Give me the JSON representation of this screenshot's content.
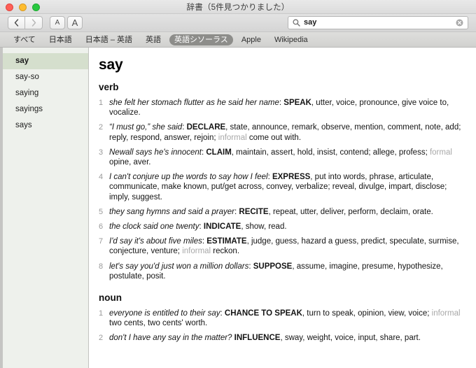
{
  "window": {
    "title": "辞書（5件見つかりました）",
    "traffic_lights": [
      "close-button",
      "minimize-button",
      "maximize-button"
    ]
  },
  "toolbar": {
    "back_label": "‹",
    "forward_label": "›",
    "text_smaller_label": "A",
    "text_larger_label": "A",
    "search": {
      "value": "say",
      "placeholder": "検索",
      "search_icon": "search-icon",
      "clear_icon": "clear-icon"
    }
  },
  "sources": {
    "items": [
      {
        "label": "すべて",
        "selected": false
      },
      {
        "label": "日本語",
        "selected": false
      },
      {
        "label": "日本語 – 英語",
        "selected": false
      },
      {
        "label": "英語",
        "selected": false
      },
      {
        "label": "英語シソーラス",
        "selected": true
      },
      {
        "label": "Apple",
        "selected": false
      },
      {
        "label": "Wikipedia",
        "selected": false
      }
    ],
    "selected_color": "#8d8d8a"
  },
  "sidebar": {
    "items": [
      {
        "label": "say",
        "selected": true
      },
      {
        "label": "say-so",
        "selected": false
      },
      {
        "label": "saying",
        "selected": false
      },
      {
        "label": "sayings",
        "selected": false
      },
      {
        "label": "says",
        "selected": false
      }
    ],
    "selected_bg": "#d5dfcd",
    "background": "#eef1ec"
  },
  "entry": {
    "headword": "say",
    "parts": [
      {
        "pos": "verb",
        "senses": [
          {
            "num": "1",
            "example": "she felt her stomach flutter as he said her name",
            "sep": ": ",
            "keyword": "SPEAK",
            "rest": ", utter, voice, pronounce, give voice to, vocalize."
          },
          {
            "num": "2",
            "example": "“I must go,” she said",
            "sep": ": ",
            "keyword": "DECLARE",
            "rest": ", state, announce, remark, observe, mention, comment, note, add; reply, respond, answer, rejoin; ",
            "register": "informal",
            "rest2": " come out with."
          },
          {
            "num": "3",
            "example": "Newall says he's innocent",
            "sep": ": ",
            "keyword": "CLAIM",
            "rest": ", maintain, assert, hold, insist, contend; allege, profess; ",
            "register": "formal",
            "rest2": " opine, aver."
          },
          {
            "num": "4",
            "example": "I can't conjure up the words to say how I feel",
            "sep": ": ",
            "keyword": "EXPRESS",
            "rest": ", put into words, phrase, articulate, communicate, make known, put/get across, convey, verbalize; reveal, divulge, impart, disclose; imply, suggest."
          },
          {
            "num": "5",
            "example": "they sang hymns and said a prayer",
            "sep": ": ",
            "keyword": "RECITE",
            "rest": ", repeat, utter, deliver, perform, declaim, orate."
          },
          {
            "num": "6",
            "example": "the clock said one twenty",
            "sep": ": ",
            "keyword": "INDICATE",
            "rest": ", show, read."
          },
          {
            "num": "7",
            "example": "I'd say it's about five miles",
            "sep": ": ",
            "keyword": "ESTIMATE",
            "rest": ", judge, guess, hazard a guess, predict, speculate, surmise, conjecture, venture; ",
            "register": "informal",
            "rest2": " reckon."
          },
          {
            "num": "8",
            "example": "let's say you'd just won a million dollars",
            "sep": ": ",
            "keyword": "SUPPOSE",
            "rest": ", assume, imagine, presume, hypothesize, postulate, posit."
          }
        ]
      },
      {
        "pos": "noun",
        "senses": [
          {
            "num": "1",
            "example": "everyone is entitled to their say",
            "sep": ": ",
            "keyword": "CHANCE TO SPEAK",
            "rest": ", turn to speak, opinion, view, voice; ",
            "register": "informal",
            "rest2": " two cents, two cents' worth."
          },
          {
            "num": "2",
            "example": "don't I have any say in the matter?",
            "sep": " ",
            "keyword": "INFLUENCE",
            "rest": ", sway, weight, voice, input, share, part."
          }
        ]
      }
    ]
  }
}
